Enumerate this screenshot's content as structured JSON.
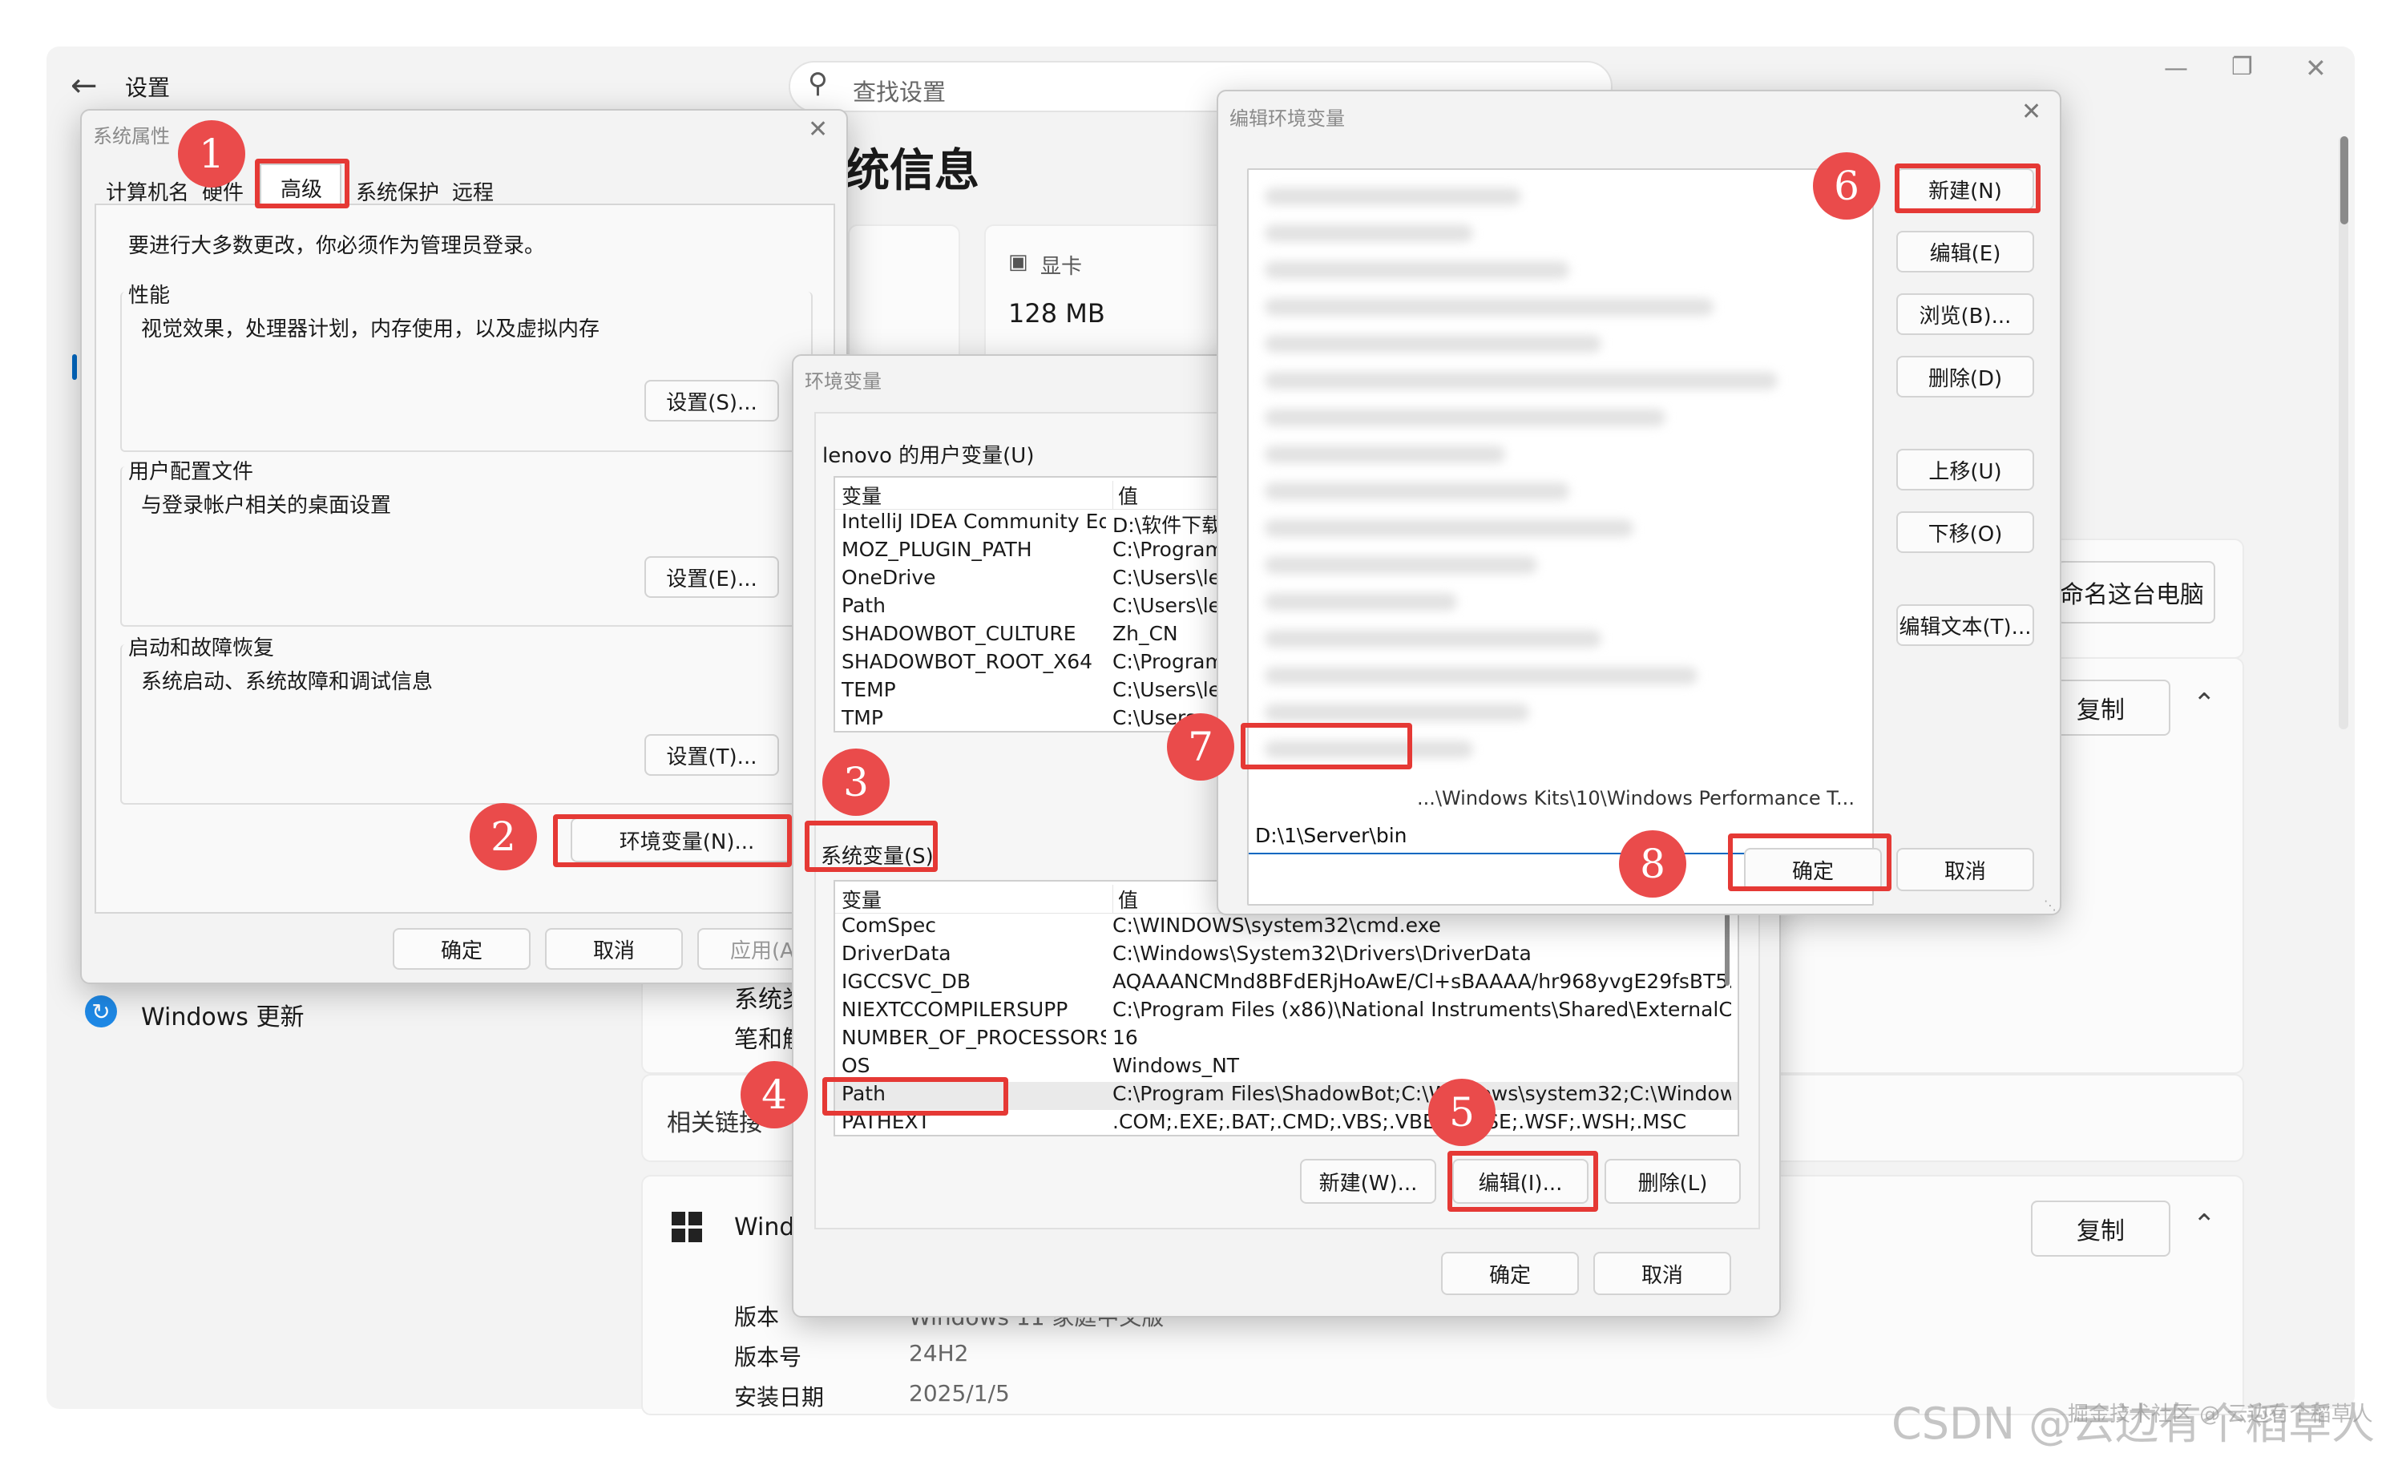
{
  "settings": {
    "back_icon": "arrow-left-icon",
    "title": "设置",
    "search_placeholder": "查找设置",
    "page_heading": "统信息",
    "gpu_label": "显卡",
    "gpu_value": "128 MB",
    "rename_button": "命名这台电脑",
    "copy1": "复制",
    "copy2": "复制",
    "windows_update": "Windows 更新",
    "related_links": "相关链接",
    "sys_label1": "系统类",
    "sys_label2": "笔和触",
    "windows_spec_label": "Windo",
    "spec": [
      {
        "k": "版本",
        "v": "Windows 11 家庭中文版"
      },
      {
        "k": "版本号",
        "v": "24H2"
      },
      {
        "k": "安装日期",
        "v": "2025/1/5"
      }
    ]
  },
  "sysprops": {
    "title": "系统属性",
    "tabs": [
      "计算机名",
      "硬件",
      "高级",
      "系统保护",
      "远程"
    ],
    "admin_note": "要进行大多数更改，你必须作为管理员登录。",
    "perf_title": "性能",
    "perf_desc": "视觉效果，处理器计划，内存使用，以及虚拟内存",
    "perf_btn": "设置(S)...",
    "profile_title": "用户配置文件",
    "profile_desc": "与登录帐户相关的桌面设置",
    "profile_btn": "设置(E)...",
    "startup_title": "启动和故障恢复",
    "startup_desc": "系统启动、系统故障和调试信息",
    "startup_btn": "设置(T)...",
    "env_btn": "环境变量(N)...",
    "ok": "确定",
    "cancel": "取消",
    "apply": "应用(A)"
  },
  "envvars": {
    "title": "环境变量",
    "user_group": "lenovo 的用户变量(U)",
    "col_var": "变量",
    "col_val": "值",
    "user_vars": [
      {
        "n": "IntelliJ IDEA Community Ed...",
        "v": "D:\\软件下载\\"
      },
      {
        "n": "MOZ_PLUGIN_PATH",
        "v": "C:\\Program"
      },
      {
        "n": "OneDrive",
        "v": "C:\\Users\\len"
      },
      {
        "n": "Path",
        "v": "C:\\Users\\len"
      },
      {
        "n": "SHADOWBOT_CULTURE",
        "v": "Zh_CN"
      },
      {
        "n": "SHADOWBOT_ROOT_X64",
        "v": "C:\\Program"
      },
      {
        "n": "TEMP",
        "v": "C:\\Users\\len"
      },
      {
        "n": "TMP",
        "v": "C:\\Users"
      }
    ],
    "sys_group": "系统变量(S)",
    "sys_vars": [
      {
        "n": "ComSpec",
        "v": "C:\\WINDOWS\\system32\\cmd.exe"
      },
      {
        "n": "DriverData",
        "v": "C:\\Windows\\System32\\Drivers\\DriverData"
      },
      {
        "n": "IGCCSVC_DB",
        "v": "AQAAANCMnd8BFdERjHoAwE/Cl+sBAAAA/hr968yvgE29fsBT5..."
      },
      {
        "n": "NIEXTCCOMPILERSUPP",
        "v": "C:\\Program Files (x86)\\National Instruments\\Shared\\ExternalCo..."
      },
      {
        "n": "NUMBER_OF_PROCESSORS",
        "v": "16"
      },
      {
        "n": "OS",
        "v": "Windows_NT"
      },
      {
        "n": "Path",
        "v": "C:\\Program Files\\ShadowBot;C:\\Windows\\system32;C:\\Window..."
      },
      {
        "n": "PATHEXT",
        "v": ".COM;.EXE;.BAT;.CMD;.VBS;.VBE;.JS;.JSE;.WSF;.WSH;.MSC"
      }
    ],
    "new_btn": "新建(W)...",
    "edit_btn": "编辑(I)...",
    "delete_btn": "删除(L)",
    "ok": "确定",
    "cancel": "取消"
  },
  "editenv": {
    "title": "编辑环境变量",
    "new_entry": "D:\\1\\Server\\bin",
    "partial_entry": "...\\Windows Kits\\10\\Windows Performance T...",
    "buttons": [
      "新建(N)",
      "编辑(E)",
      "浏览(B)...",
      "删除(D)",
      "上移(U)",
      "下移(O)",
      "编辑文本(T)..."
    ],
    "ok": "确定",
    "cancel": "取消"
  },
  "steps": [
    "1",
    "2",
    "3",
    "4",
    "5",
    "6",
    "7",
    "8"
  ],
  "watermark": "CSDN @云边有个稻草人",
  "watermark_sub": "掘金技术社区 @ 云边有个稻草人",
  "colors": {
    "highlight": "#e53935",
    "step_circle": "#ea4b4b"
  }
}
